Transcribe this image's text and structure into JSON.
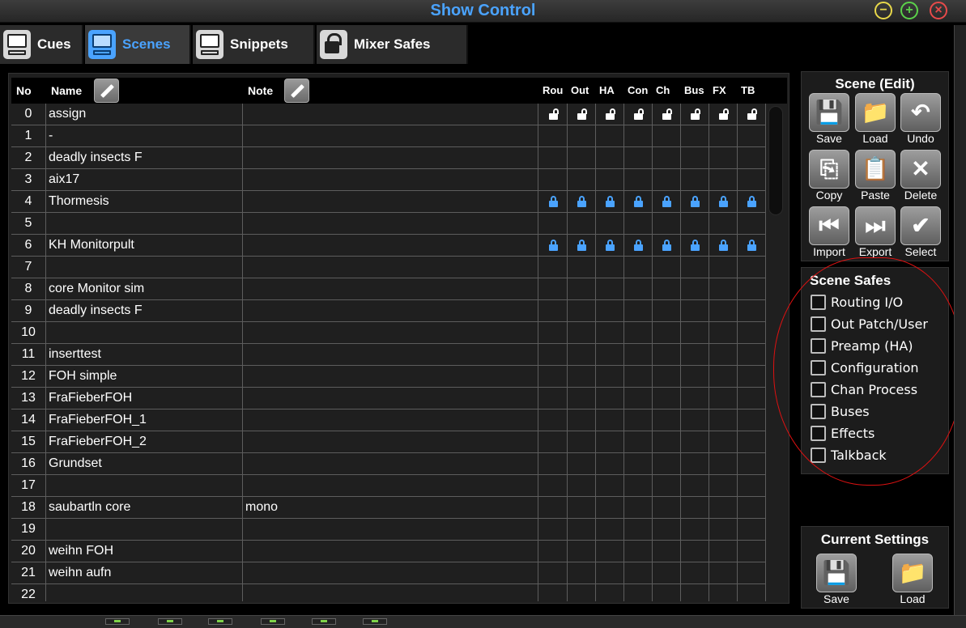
{
  "window": {
    "title": "Show Control"
  },
  "tabs": [
    {
      "label": "Cues",
      "icon": "monitor-icon"
    },
    {
      "label": "Scenes",
      "icon": "monitor-icon",
      "active": true
    },
    {
      "label": "Snippets",
      "icon": "monitor-icon"
    },
    {
      "label": "Mixer Safes",
      "icon": "lock-icon"
    }
  ],
  "table": {
    "headers": {
      "no": "No",
      "name": "Name",
      "note": "Note"
    },
    "safe_headers": [
      "Rou",
      "Out",
      "HA",
      "Con",
      "Ch",
      "Bus",
      "FX",
      "TB"
    ],
    "rows": [
      {
        "no": "0",
        "name": "assign",
        "note": "",
        "locks": "open"
      },
      {
        "no": "1",
        "name": "-",
        "note": "",
        "locks": "none"
      },
      {
        "no": "2",
        "name": "deadly insects F",
        "note": "",
        "locks": "none"
      },
      {
        "no": "3",
        "name": "aix17",
        "note": "",
        "locks": "none"
      },
      {
        "no": "4",
        "name": "Thormesis",
        "note": "",
        "locks": "closed"
      },
      {
        "no": "5",
        "name": "",
        "note": "",
        "locks": "none"
      },
      {
        "no": "6",
        "name": "KH Monitorpult",
        "note": "",
        "locks": "closed"
      },
      {
        "no": "7",
        "name": "",
        "note": "",
        "locks": "none"
      },
      {
        "no": "8",
        "name": "core Monitor sim",
        "note": "",
        "locks": "none"
      },
      {
        "no": "9",
        "name": "deadly insects F",
        "note": "",
        "locks": "none"
      },
      {
        "no": "10",
        "name": "",
        "note": "",
        "locks": "none"
      },
      {
        "no": "11",
        "name": "inserttest",
        "note": "",
        "locks": "none"
      },
      {
        "no": "12",
        "name": "FOH simple",
        "note": "",
        "locks": "none"
      },
      {
        "no": "13",
        "name": "FraFieberFOH",
        "note": "",
        "locks": "none"
      },
      {
        "no": "14",
        "name": "FraFieberFOH_1",
        "note": "",
        "locks": "none"
      },
      {
        "no": "15",
        "name": "FraFieberFOH_2",
        "note": "",
        "locks": "none"
      },
      {
        "no": "16",
        "name": "Grundset",
        "note": "",
        "locks": "none"
      },
      {
        "no": "17",
        "name": "",
        "note": "",
        "locks": "none"
      },
      {
        "no": "18",
        "name": "saubartln core",
        "note": "mono",
        "locks": "none"
      },
      {
        "no": "19",
        "name": "",
        "note": "",
        "locks": "none"
      },
      {
        "no": "20",
        "name": "weihn FOH",
        "note": "",
        "locks": "none"
      },
      {
        "no": "21",
        "name": "weihn aufn",
        "note": "",
        "locks": "none"
      },
      {
        "no": "22",
        "name": "",
        "note": "",
        "locks": "none"
      }
    ]
  },
  "scene_edit": {
    "title": "Scene (Edit)",
    "buttons": [
      {
        "label": "Save",
        "icon": "floppy-icon",
        "glyph": "💾"
      },
      {
        "label": "Load",
        "icon": "folder-icon",
        "glyph": "📁"
      },
      {
        "label": "Undo",
        "icon": "undo-icon",
        "glyph": "↶"
      },
      {
        "label": "Copy",
        "icon": "copy-icon",
        "glyph": "⎘"
      },
      {
        "label": "Paste",
        "icon": "paste-icon",
        "glyph": "📋"
      },
      {
        "label": "Delete",
        "icon": "delete-icon",
        "glyph": "✕"
      },
      {
        "label": "Import",
        "icon": "import-icon",
        "glyph": "⏮"
      },
      {
        "label": "Export",
        "icon": "export-icon",
        "glyph": "⏭"
      },
      {
        "label": "Select",
        "icon": "check-icon",
        "glyph": "✔"
      }
    ]
  },
  "scene_safes": {
    "title": "Scene Safes",
    "items": [
      "Routing I/O",
      "Out Patch/User",
      "Preamp (HA)",
      "Configuration",
      "Chan Process",
      "Buses",
      "Effects",
      "Talkback"
    ]
  },
  "current_settings": {
    "title": "Current Settings",
    "save_label": "Save",
    "load_label": "Load"
  },
  "colors": {
    "accent": "#4aa3ff",
    "annotation": "#d11111"
  }
}
